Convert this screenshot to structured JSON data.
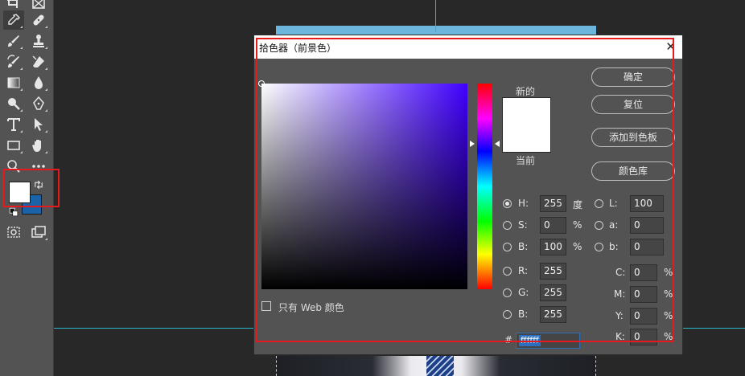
{
  "dialog": {
    "title": "拾色器（前景色）",
    "close_glyph": "✕",
    "label_new": "新的",
    "label_current": "当前",
    "buttons": {
      "ok": "确定",
      "reset": "复位",
      "add_swatch": "添加到色板",
      "color_library": "颜色库"
    },
    "hsb": {
      "h": {
        "label": "H:",
        "value": "255",
        "unit": "度",
        "selected": true
      },
      "s": {
        "label": "S:",
        "value": "0",
        "unit": "%"
      },
      "b": {
        "label": "B:",
        "value": "100",
        "unit": "%"
      }
    },
    "lab": {
      "l": {
        "label": "L:",
        "value": "100"
      },
      "a": {
        "label": "a:",
        "value": "0"
      },
      "b": {
        "label": "b:",
        "value": "0"
      }
    },
    "rgb": {
      "r": {
        "label": "R:",
        "value": "255"
      },
      "g": {
        "label": "G:",
        "value": "255"
      },
      "b": {
        "label": "B:",
        "value": "255"
      }
    },
    "cmyk": {
      "c": {
        "label": "C:",
        "value": "0",
        "unit": "%"
      },
      "m": {
        "label": "M:",
        "value": "0",
        "unit": "%"
      },
      "y": {
        "label": "Y:",
        "value": "0",
        "unit": "%"
      },
      "k": {
        "label": "K:",
        "value": "0",
        "unit": "%"
      }
    },
    "web_only_label": "只有 Web 颜色",
    "hex": {
      "label": "#",
      "value": "ffffff"
    },
    "new_color": "#ffffff",
    "current_color": "#ffffff",
    "field_hue_color": "#4000ff"
  },
  "toolbar": {
    "foreground_color": "#ffffff",
    "background_color": "#1a63a8",
    "icons": [
      "artboard-icon",
      "frame-icon",
      "eyedropper-icon",
      "healing-brush-icon",
      "brush-icon",
      "clone-stamp-icon",
      "history-brush-icon",
      "eraser-icon",
      "gradient-icon",
      "blur-icon",
      "dodge-icon",
      "pen-icon",
      "type-icon",
      "path-select-icon",
      "rectangle-icon",
      "hand-icon",
      "zoom-icon",
      "more-tools-icon",
      "quick-mask-icon",
      "screen-mode-icon"
    ]
  },
  "annotation_color": "#e8191c"
}
